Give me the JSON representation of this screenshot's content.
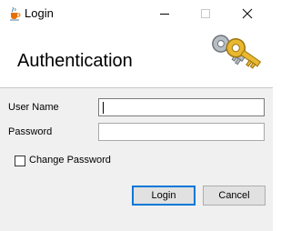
{
  "window": {
    "title": "Login",
    "icon": "java-cup-icon",
    "controls": [
      "minimize-icon",
      "maximize-icon",
      "close-icon"
    ]
  },
  "header": {
    "title": "Authentication",
    "icon": "keys-icon"
  },
  "form": {
    "username_label": "User Name",
    "username_value": "",
    "password_label": "Password",
    "password_value": "",
    "change_password_label": "Change Password",
    "change_password_checked": false
  },
  "buttons": {
    "login": "Login",
    "cancel": "Cancel"
  },
  "colors": {
    "accent": "#0078d7",
    "content_bg": "#f0f0f0",
    "key_gold": "#d4a21c",
    "key_silver": "#9aa2aa"
  }
}
